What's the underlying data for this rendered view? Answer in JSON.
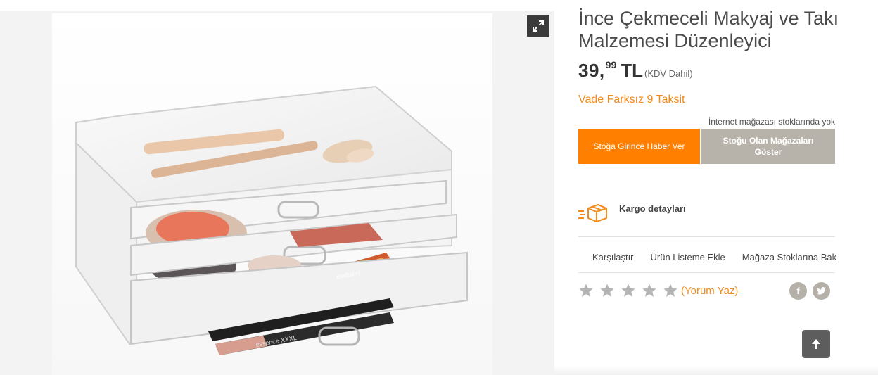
{
  "product": {
    "title": "İnce Çekmeceli Makyaj ve Takı Malzemesi Düzenleyici",
    "price_integer": "39,",
    "price_decimal": "99",
    "currency": "TL",
    "vat_note": "(KDV Dahil)",
    "installment_text": "Vade Farksız 9 Taksit",
    "stock_note": "İnternet mağazası stoklarında yok"
  },
  "gallery": {
    "expand_icon": "expand-arrows-icon",
    "photo_text": {
      "brush_label": "",
      "palette_label": "theBalm",
      "lipgloss_label": "essence XXXL"
    }
  },
  "buttons": {
    "notify_label": "Stoğa Girince Haber Ver",
    "stores_label": "Stoğu Olan Mağazaları Göster"
  },
  "shipping": {
    "label": "Kargo detayları",
    "icon": "cargo-box-icon"
  },
  "actions": {
    "compare": "Karşılaştır",
    "add_to_list": "Ürün Listeme Ekle",
    "store_stock": "Mağaza Stoklarına Bak"
  },
  "rating": {
    "stars_filled": 0,
    "stars_total": 5,
    "review_link": "(Yorum Yaz)"
  },
  "social": {
    "facebook": "f",
    "twitter_icon": "twitter-icon"
  },
  "colors": {
    "accent_orange": "#ff8000",
    "link_orange": "#f28a1c",
    "secondary_button": "#b8b3aa",
    "star_gray": "#b5b5b5"
  }
}
